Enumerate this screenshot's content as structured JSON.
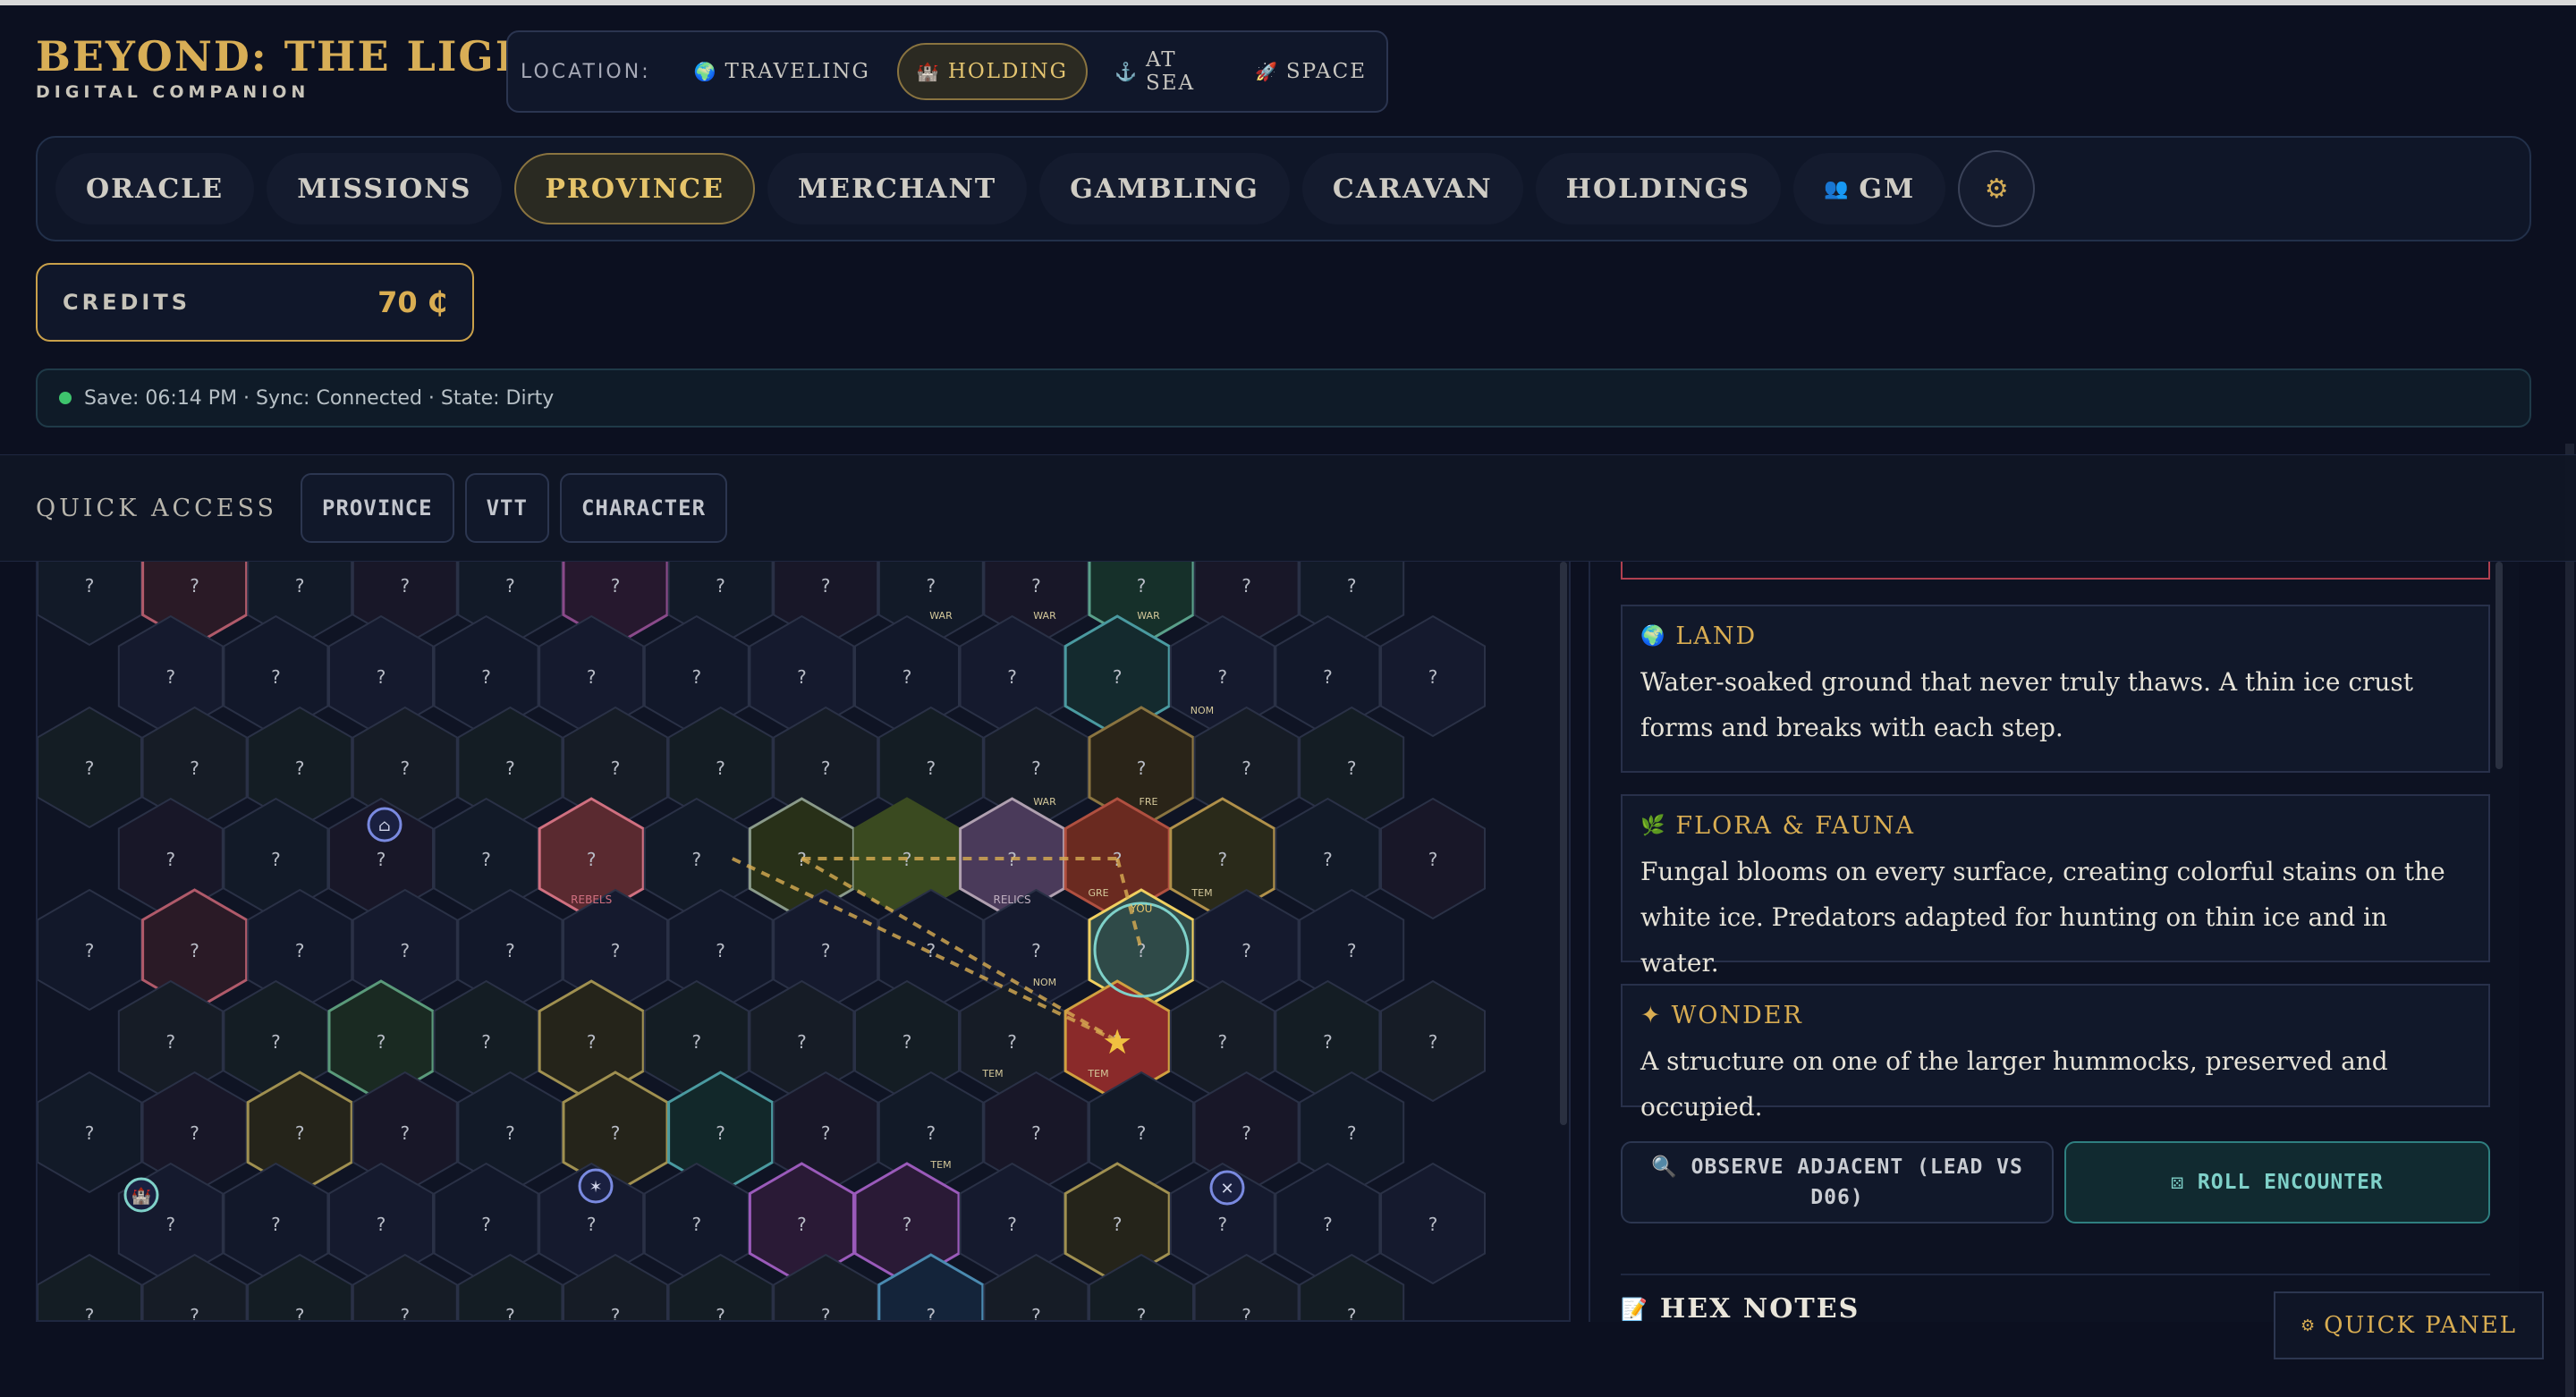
{
  "brand": {
    "title": "BEYOND: THE LIGHT",
    "subtitle": "DIGITAL COMPANION"
  },
  "location": {
    "label": "LOCATION:",
    "options": [
      {
        "icon": "🌍",
        "label": "TRAVELING",
        "active": false
      },
      {
        "icon": "🏰",
        "label": "HOLDING",
        "active": true
      },
      {
        "icon": "⚓",
        "label": "AT SEA",
        "active": false
      },
      {
        "icon": "🚀",
        "label": "SPACE",
        "active": false
      }
    ]
  },
  "nav": {
    "tabs": [
      {
        "label": "ORACLE",
        "active": false
      },
      {
        "label": "MISSIONS",
        "active": false
      },
      {
        "label": "PROVINCE",
        "active": true
      },
      {
        "label": "MERCHANT",
        "active": false
      },
      {
        "label": "GAMBLING",
        "active": false
      },
      {
        "label": "CARAVAN",
        "active": false
      },
      {
        "label": "HOLDINGS",
        "active": false
      },
      {
        "label": "GM",
        "active": false,
        "icon": "👥"
      }
    ],
    "settings_icon": "⚙"
  },
  "credits": {
    "label": "CREDITS",
    "value": "70 ₵"
  },
  "status": {
    "text": "Save: 06:14 PM · Sync: Connected · State: Dirty"
  },
  "quick_access": {
    "label": "QUICK ACCESS",
    "buttons": [
      "PROVINCE",
      "VTT",
      "CHARACTER"
    ]
  },
  "map": {
    "unknown_glyph": "?",
    "labels": {
      "war": "WAR",
      "nom": "NOM",
      "fre": "FRE",
      "gre": "GRE",
      "tem": "TEM",
      "rebels": "REBELS",
      "relics": "RELICS",
      "you": "YOU"
    }
  },
  "detail": {
    "obscured_button": "⚄ LEAD VS D06",
    "cards": [
      {
        "icon": "🌍",
        "title": "LAND",
        "body": "Water-soaked ground that never truly thaws. A thin ice crust forms and breaks with each step."
      },
      {
        "icon": "🌿",
        "title": "FLORA & FAUNA",
        "body": "Fungal blooms on every surface, creating colorful stains on the white ice. Predators adapted for hunting on thin ice and in water."
      },
      {
        "icon": "✦",
        "title": "WONDER",
        "body": "A structure on one of the larger hummocks, preserved and occupied."
      }
    ],
    "observe_button": {
      "icon": "🔍",
      "label": "OBSERVE ADJACENT (LEAD VS D06)"
    },
    "roll_button": {
      "icon": "⚄",
      "label": "ROLL ENCOUNTER"
    },
    "hex_notes": {
      "icon": "📝",
      "label": "HEX NOTES"
    }
  },
  "quick_panel": {
    "icon": "⚙",
    "label": "QUICK PANEL"
  },
  "colors": {
    "accent": "#d9ad52",
    "teal": "#7fd1c9",
    "danger": "#b04050",
    "bg": "#0c1020"
  }
}
